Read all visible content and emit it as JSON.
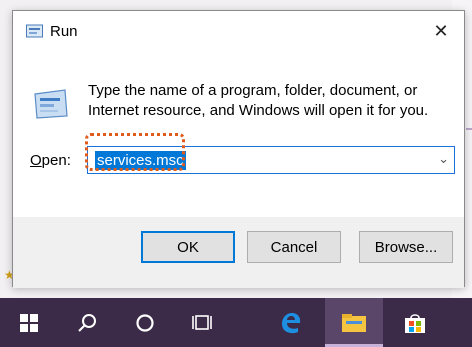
{
  "dialog": {
    "title": "Run",
    "description": "Type the name of a program, folder, document, or Internet resource, and Windows will open it for you.",
    "open_label_prefix": "O",
    "open_label_rest": "pen:",
    "combo_value": "services.msc",
    "buttons": {
      "ok": "OK",
      "cancel": "Cancel",
      "browse": "Browse..."
    }
  },
  "taskbar": {
    "items": [
      "start-icon",
      "search-icon",
      "cortana-icon",
      "task-view-icon",
      "edge-icon",
      "file-explorer-icon",
      "store-icon"
    ],
    "active_item": "file-explorer-icon"
  },
  "colors": {
    "selection": "#0078d7",
    "highlight_ring": "#e05a1c",
    "taskbar": "#3b2b49"
  }
}
